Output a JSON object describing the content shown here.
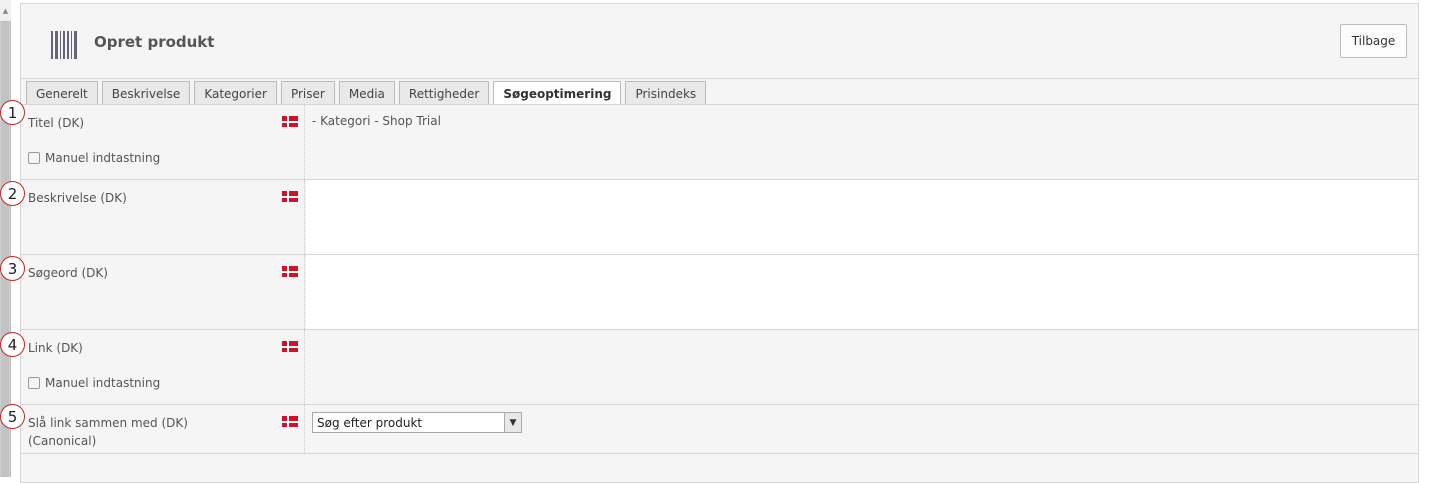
{
  "header": {
    "title": "Opret produkt",
    "back_label": "Tilbage"
  },
  "tabs": [
    {
      "label": "Generelt",
      "active": false
    },
    {
      "label": "Beskrivelse",
      "active": false
    },
    {
      "label": "Kategorier",
      "active": false
    },
    {
      "label": "Priser",
      "active": false
    },
    {
      "label": "Media",
      "active": false
    },
    {
      "label": "Rettigheder",
      "active": false
    },
    {
      "label": "Søgeoptimering",
      "active": true
    },
    {
      "label": "Prisindeks",
      "active": false
    }
  ],
  "fields": {
    "title": {
      "label": "Titel (DK)",
      "value": "- Kategori - Shop Trial",
      "checkbox_label": "Manuel indtastning"
    },
    "description": {
      "label": "Beskrivelse (DK)",
      "value": ""
    },
    "keywords": {
      "label": "Søgeord (DK)",
      "value": ""
    },
    "link": {
      "label": "Link (DK)",
      "value": "",
      "checkbox_label": "Manuel indtastning"
    },
    "canonical": {
      "label_line1": "Slå link sammen med (DK)",
      "label_line2": "(Canonical)",
      "select_value": "Søg efter produkt"
    }
  },
  "markers": [
    "1",
    "2",
    "3",
    "4",
    "5"
  ],
  "flag": "danish-flag-icon",
  "colors": {
    "flag_red": "#d2102a",
    "marker_border": "#cc2222"
  }
}
